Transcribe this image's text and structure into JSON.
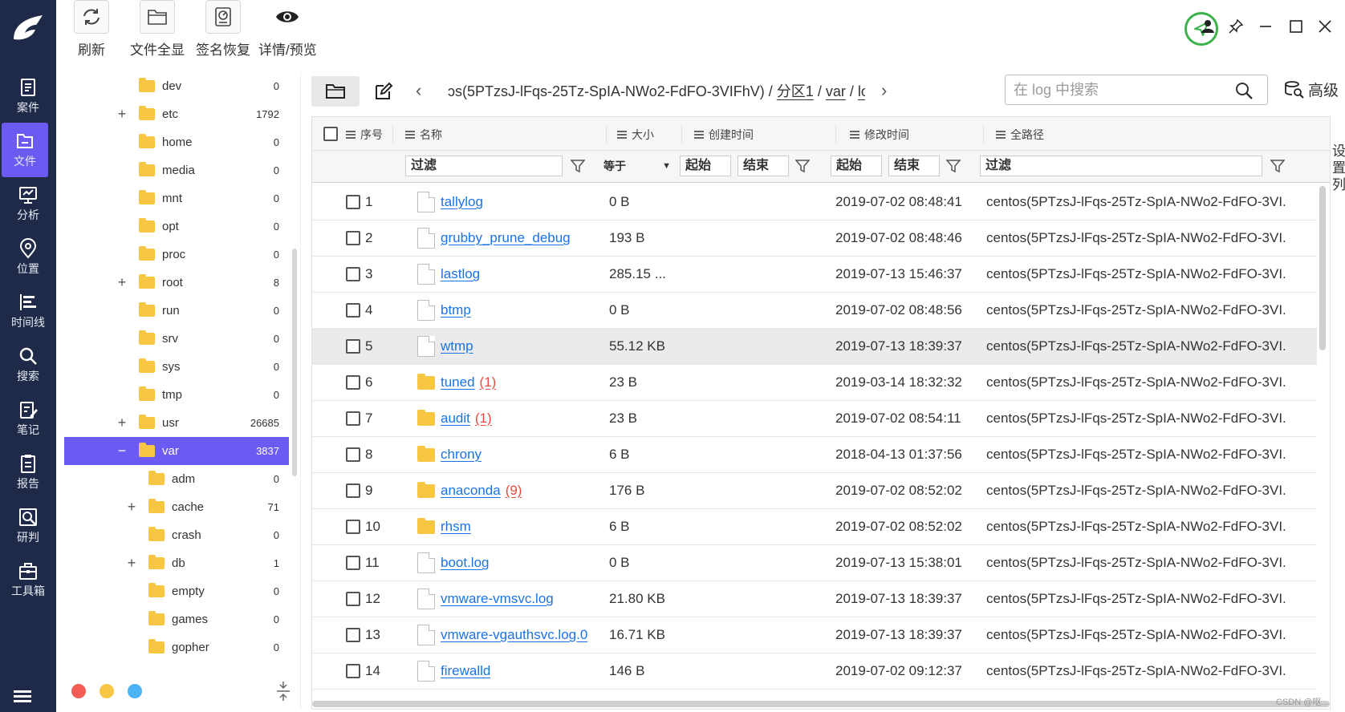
{
  "app": {
    "nav": [
      {
        "label": "案件",
        "icon": "case-icon"
      },
      {
        "label": "文件",
        "icon": "file-icon"
      },
      {
        "label": "分析",
        "icon": "analysis-icon"
      },
      {
        "label": "位置",
        "icon": "location-icon"
      },
      {
        "label": "时间线",
        "icon": "timeline-icon"
      },
      {
        "label": "搜索",
        "icon": "search-icon"
      },
      {
        "label": "笔记",
        "icon": "note-icon"
      },
      {
        "label": "报告",
        "icon": "report-icon"
      },
      {
        "label": "研判",
        "icon": "judge-icon"
      },
      {
        "label": "工具箱",
        "icon": "toolbox-icon"
      }
    ],
    "active_nav": "文件",
    "accent": "#6b5bf2",
    "rail_color": "#1f2a48"
  },
  "toolbar": {
    "refresh": "刷新",
    "show_all": "文件全显",
    "signature_recover": "签名恢复",
    "detail_preview": "详情/预览"
  },
  "tree": {
    "items": [
      {
        "name": "dev",
        "count": "0",
        "expand": ""
      },
      {
        "name": "etc",
        "count": "1792",
        "expand": "+"
      },
      {
        "name": "home",
        "count": "0",
        "expand": ""
      },
      {
        "name": "media",
        "count": "0",
        "expand": ""
      },
      {
        "name": "mnt",
        "count": "0",
        "expand": ""
      },
      {
        "name": "opt",
        "count": "0",
        "expand": ""
      },
      {
        "name": "proc",
        "count": "0",
        "expand": ""
      },
      {
        "name": "root",
        "count": "8",
        "expand": "+"
      },
      {
        "name": "run",
        "count": "0",
        "expand": ""
      },
      {
        "name": "srv",
        "count": "0",
        "expand": ""
      },
      {
        "name": "sys",
        "count": "0",
        "expand": ""
      },
      {
        "name": "tmp",
        "count": "0",
        "expand": ""
      },
      {
        "name": "usr",
        "count": "26685",
        "expand": "+"
      },
      {
        "name": "var",
        "count": "3837",
        "expand": "−"
      },
      {
        "name": "adm",
        "count": "0",
        "expand": ""
      },
      {
        "name": "cache",
        "count": "71",
        "expand": "+"
      },
      {
        "name": "crash",
        "count": "0",
        "expand": ""
      },
      {
        "name": "db",
        "count": "1",
        "expand": "+"
      },
      {
        "name": "empty",
        "count": "0",
        "expand": ""
      },
      {
        "name": "games",
        "count": "0",
        "expand": ""
      },
      {
        "name": "gopher",
        "count": "0",
        "expand": ""
      }
    ]
  },
  "path": {
    "prefix": "ɔs(5PTzsJ-lFqs-25Tz-SpIA-NWo2-FdFO-3VIFhV)",
    "sep1": "/",
    "partition": "分区1",
    "sep2": "/",
    "dir1": "var",
    "sep3": "/",
    "dir2": "log"
  },
  "search": {
    "placeholder": "在 log 中搜索"
  },
  "advanced": "高级",
  "grid": {
    "headers": {
      "index": "序号",
      "name": "名称",
      "size": "大小",
      "created": "创建时间",
      "modified": "修改时间",
      "fullpath": "全路径"
    },
    "filters": {
      "name": "过滤",
      "size_op": "等于",
      "created_start": "起始",
      "created_end": "结束",
      "modified_start": "起始",
      "modified_end": "结束",
      "path": "过滤"
    },
    "rows": [
      {
        "idx": "1",
        "name": "tallylog",
        "type": "file",
        "badge": "",
        "size": "0 B",
        "modified": "2019-07-02 08:48:41",
        "path": "centos(5PTzsJ-lFqs-25Tz-SpIA-NWo2-FdFO-3VI."
      },
      {
        "idx": "2",
        "name": "grubby_prune_debug",
        "type": "file",
        "badge": "",
        "size": "193 B",
        "modified": "2019-07-02 08:48:46",
        "path": "centos(5PTzsJ-lFqs-25Tz-SpIA-NWo2-FdFO-3VI."
      },
      {
        "idx": "3",
        "name": "lastlog",
        "type": "file",
        "badge": "",
        "size": "285.15 ...",
        "modified": "2019-07-13 15:46:37",
        "path": "centos(5PTzsJ-lFqs-25Tz-SpIA-NWo2-FdFO-3VI."
      },
      {
        "idx": "4",
        "name": "btmp",
        "type": "file",
        "badge": "",
        "size": "0 B",
        "modified": "2019-07-02 08:48:56",
        "path": "centos(5PTzsJ-lFqs-25Tz-SpIA-NWo2-FdFO-3VI."
      },
      {
        "idx": "5",
        "name": "wtmp",
        "type": "file",
        "badge": "",
        "size": "55.12 KB",
        "modified": "2019-07-13 18:39:37",
        "path": "centos(5PTzsJ-lFqs-25Tz-SpIA-NWo2-FdFO-3VI."
      },
      {
        "idx": "6",
        "name": "tuned",
        "type": "dir",
        "badge": "(1)",
        "size": "23 B",
        "modified": "2019-03-14 18:32:32",
        "path": "centos(5PTzsJ-lFqs-25Tz-SpIA-NWo2-FdFO-3VI."
      },
      {
        "idx": "7",
        "name": "audit",
        "type": "dir",
        "badge": "(1)",
        "size": "23 B",
        "modified": "2019-07-02 08:54:11",
        "path": "centos(5PTzsJ-lFqs-25Tz-SpIA-NWo2-FdFO-3VI."
      },
      {
        "idx": "8",
        "name": "chrony",
        "type": "dir",
        "badge": "",
        "size": "6 B",
        "modified": "2018-04-13 01:37:56",
        "path": "centos(5PTzsJ-lFqs-25Tz-SpIA-NWo2-FdFO-3VI."
      },
      {
        "idx": "9",
        "name": "anaconda",
        "type": "dir",
        "badge": "(9)",
        "size": "176 B",
        "modified": "2019-07-02 08:52:02",
        "path": "centos(5PTzsJ-lFqs-25Tz-SpIA-NWo2-FdFO-3VI."
      },
      {
        "idx": "10",
        "name": "rhsm",
        "type": "dir",
        "badge": "",
        "size": "6 B",
        "modified": "2019-07-02 08:52:02",
        "path": "centos(5PTzsJ-lFqs-25Tz-SpIA-NWo2-FdFO-3VI."
      },
      {
        "idx": "11",
        "name": "boot.log",
        "type": "file",
        "badge": "",
        "size": "0 B",
        "modified": "2019-07-13 15:38:01",
        "path": "centos(5PTzsJ-lFqs-25Tz-SpIA-NWo2-FdFO-3VI."
      },
      {
        "idx": "12",
        "name": "vmware-vmsvc.log",
        "type": "file",
        "badge": "",
        "size": "21.80 KB",
        "modified": "2019-07-13 18:39:37",
        "path": "centos(5PTzsJ-lFqs-25Tz-SpIA-NWo2-FdFO-3VI."
      },
      {
        "idx": "13",
        "name": "vmware-vgauthsvc.log.0",
        "type": "file",
        "badge": "",
        "size": "16.71 KB",
        "modified": "2019-07-13 18:39:37",
        "path": "centos(5PTzsJ-lFqs-25Tz-SpIA-NWo2-FdFO-3VI."
      },
      {
        "idx": "14",
        "name": "firewalld",
        "type": "file",
        "badge": "",
        "size": "146 B",
        "modified": "2019-07-02 09:12:37",
        "path": "centos(5PTzsJ-lFqs-25Tz-SpIA-NWo2-FdFO-3VI."
      }
    ],
    "highlighted_row": "5"
  },
  "column_settings": "设置列",
  "status_dots": [
    "#f25c54",
    "#f7c744",
    "#4cb4f5"
  ],
  "watermark": "CSDN @呕..."
}
